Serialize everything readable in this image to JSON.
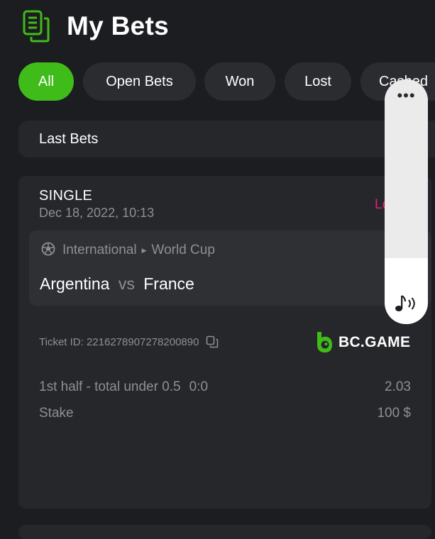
{
  "header": {
    "title": "My Bets",
    "icon": "bets-list-icon"
  },
  "filters": [
    {
      "label": "All",
      "active": true
    },
    {
      "label": "Open Bets",
      "active": false
    },
    {
      "label": "Won",
      "active": false
    },
    {
      "label": "Lost",
      "active": false
    },
    {
      "label": "Cashed",
      "active": false
    }
  ],
  "section_title": "Last Bets",
  "bet": {
    "type": "SINGLE",
    "date": "Dec 18, 2022, 10:13",
    "status": "Lost",
    "event": {
      "category": "International",
      "league": "World Cup",
      "team_home": "Argentina",
      "vs": "vs",
      "team_away": "France"
    },
    "ticket_id": "Ticket ID: 2216278907278200890",
    "brand": "BC.GAME",
    "selection": "1st half - total under 0.5",
    "score": "0:0",
    "odds": "2.03",
    "stake_label": "Stake",
    "stake_value": "100 $"
  },
  "overlay": {
    "menu": "•••",
    "icon": "sound-icon"
  },
  "colors": {
    "background": "#1c1d20",
    "card": "#26272b",
    "accent_green": "#3fbc19",
    "status_lost": "#e3207a",
    "muted_text": "#8e8f94"
  }
}
